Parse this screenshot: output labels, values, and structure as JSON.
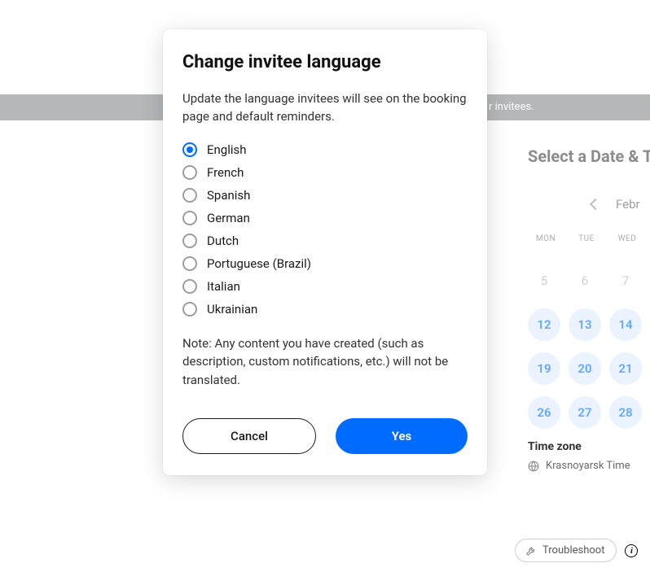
{
  "modal": {
    "title": "Change invitee language",
    "description": "Update the language invitees will see on the booking page and default reminders.",
    "note": "Note: Any content you have created (such as description, custom notifications, etc.) will not be translated.",
    "languages": [
      {
        "label": "English",
        "selected": true
      },
      {
        "label": "French",
        "selected": false
      },
      {
        "label": "Spanish",
        "selected": false
      },
      {
        "label": "German",
        "selected": false
      },
      {
        "label": "Dutch",
        "selected": false
      },
      {
        "label": "Portuguese (Brazil)",
        "selected": false
      },
      {
        "label": "Italian",
        "selected": false
      },
      {
        "label": "Ukrainian",
        "selected": false
      }
    ],
    "cancel_label": "Cancel",
    "yes_label": "Yes"
  },
  "background": {
    "banner_fragment": "r invitees.",
    "select_heading": "Select a Date & T",
    "month_fragment": "Febr",
    "dow": [
      "MON",
      "TUE",
      "WED"
    ],
    "rows": [
      [
        {
          "n": "5",
          "muted": true
        },
        {
          "n": "6",
          "muted": true
        },
        {
          "n": "7",
          "muted": true
        }
      ],
      [
        {
          "n": "12",
          "muted": false
        },
        {
          "n": "13",
          "muted": false
        },
        {
          "n": "14",
          "muted": false
        }
      ],
      [
        {
          "n": "19",
          "muted": false
        },
        {
          "n": "20",
          "muted": false
        },
        {
          "n": "21",
          "muted": false
        }
      ],
      [
        {
          "n": "26",
          "muted": false
        },
        {
          "n": "27",
          "muted": false
        },
        {
          "n": "28",
          "muted": false
        }
      ]
    ],
    "timezone_label": "Time zone",
    "timezone_value": "Krasnoyarsk Time",
    "troubleshoot_label": "Troubleshoot"
  }
}
